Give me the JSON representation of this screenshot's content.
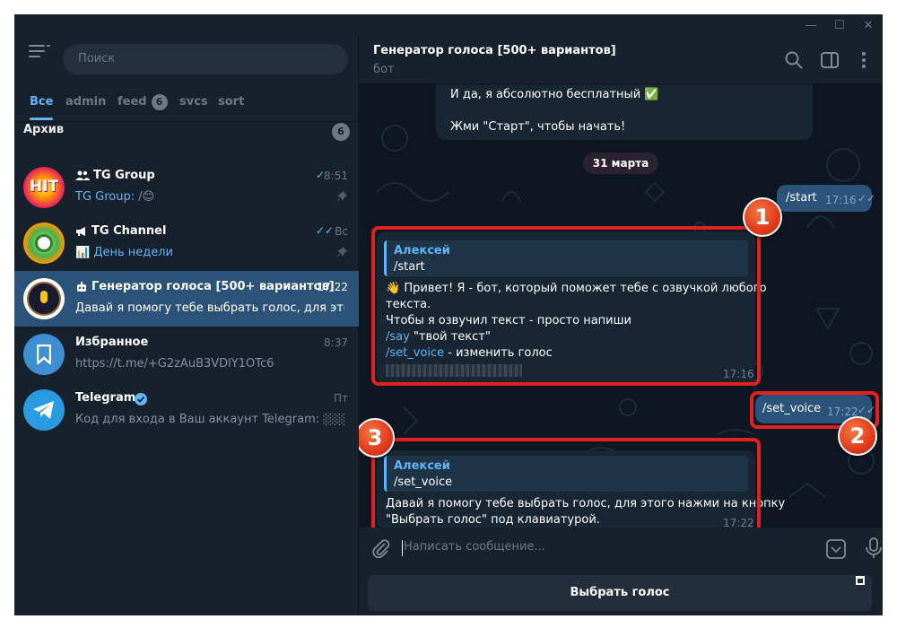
{
  "window": {
    "minimize": "—",
    "maximize": "☐",
    "close": "✕"
  },
  "sidebar": {
    "search_placeholder": "Поиск",
    "folders": [
      {
        "label": "Все",
        "active": true
      },
      {
        "label": "admin"
      },
      {
        "label": "feed",
        "badge": "6"
      },
      {
        "label": "svcs"
      },
      {
        "label": "sort"
      }
    ],
    "archive": {
      "label": "Архив",
      "count": "6"
    },
    "chats": [
      {
        "name": "TG Group",
        "time": "8:51",
        "preview_prefix": "TG Group:",
        "preview": " /😊"
      },
      {
        "name": "TG Channel",
        "time": "Вс",
        "preview": "📊 День недели"
      },
      {
        "name": "Генератор голоса [500+ вариантов]",
        "time": "17:22",
        "preview": "Давай я помогу тебе выбрать голос, для этого ..."
      },
      {
        "name": "Избранное",
        "time": "8:37",
        "preview": "https://t.me/+G2zAuB3VDlY1OTc6"
      },
      {
        "name": "Telegram",
        "time": "Пт",
        "preview": "Код для входа в Ваш аккаунт Telegram: ░░░░ Н..."
      }
    ],
    "avatar_hit_text": "HIT"
  },
  "header": {
    "title": "Генератор голоса [500+ вариантов]",
    "subtitle": "бот"
  },
  "messages": {
    "top_line1": "И да, я абсолютно бесплатный ✅",
    "top_line2": "Жми \"Старт\", чтобы начать!",
    "date": "31 марта",
    "out1": {
      "text": "/start",
      "time": "17:16"
    },
    "in1": {
      "reply_name": "Алексей",
      "reply_text": "/start",
      "line1": "👋 Привет! Я - бот, который поможет тебе с озвучкой любого",
      "line2": "текста.",
      "line3": "Чтобы я озвучил текст - просто напиши",
      "line4_cmd": "/say",
      "line4_rest": " \"твой текст\"",
      "line5_cmd": "/set_voice",
      "line5_rest": " - изменить голос",
      "time": "17:16"
    },
    "out2": {
      "text": "/set_voice",
      "time": "17:22"
    },
    "in2": {
      "reply_name": "Алексей",
      "reply_text": "/set_voice",
      "line1": "Давай я помогу тебе выбрать голос, для этого нажми на кнопку",
      "line2": "\"Выбрать голос\" под клавиатурой.",
      "time": "17:22"
    }
  },
  "annotations": [
    "1",
    "2",
    "3"
  ],
  "composer": {
    "placeholder": "Написать сообщение..."
  },
  "keyboard": {
    "button": "Выбрать голос"
  },
  "colors": {
    "accent": "#5eb5f7",
    "highlight": "#e0211d",
    "bg": "#0e1621",
    "panel": "#17212b"
  }
}
